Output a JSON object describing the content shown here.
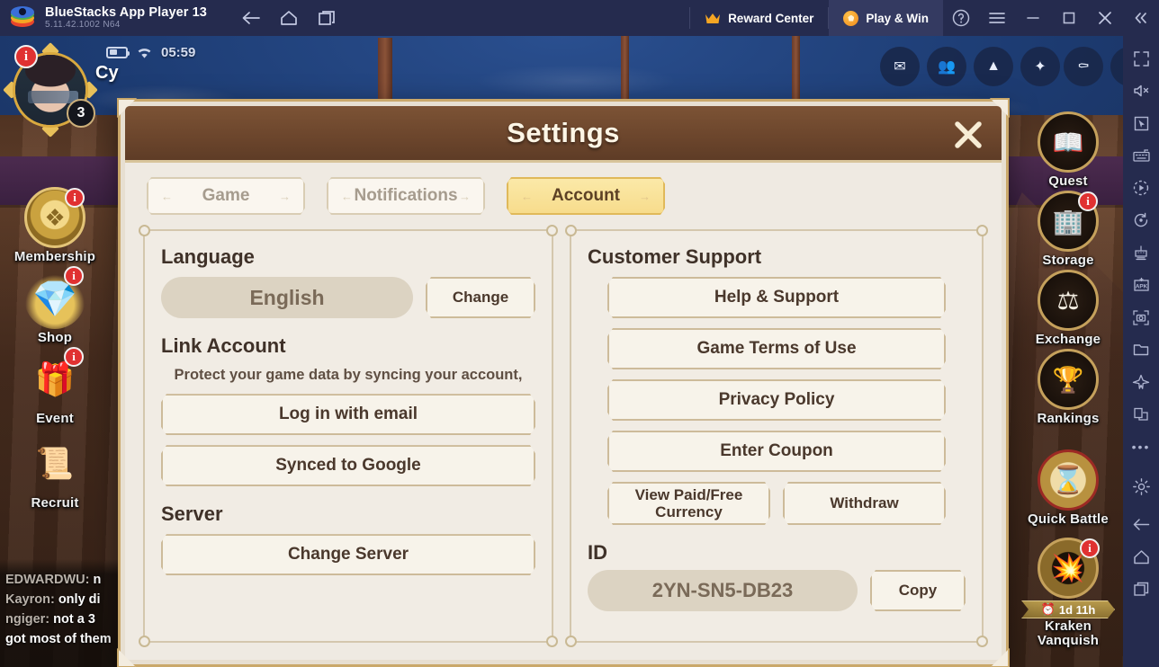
{
  "titlebar": {
    "app_name": "BlueStacks App Player 13",
    "version": "5.11.42.1002  N64",
    "back_icon": "back-arrow-icon",
    "home_icon": "home-icon",
    "multi_instance_icon": "multi-instance-icon",
    "reward_center": "Reward Center",
    "play_and_win": "Play & Win",
    "help_icon": "help-icon",
    "menu_icon": "hamburger-menu-icon",
    "minimize_icon": "minimize-icon",
    "maximize_icon": "maximize-icon",
    "close_icon": "close-icon",
    "collapse_icon": "collapse-chevrons-icon",
    "accent": "#f5a623",
    "bar_bg": "#252b4e"
  },
  "game": {
    "status": {
      "time": "05:59",
      "battery_icon": "battery-icon",
      "wifi_icon": "wifi-icon"
    },
    "player": {
      "name": "Cy",
      "level": "3",
      "alert": "i"
    },
    "left_menu": [
      {
        "label": "Membership",
        "icon": "membership-emblem-icon",
        "badge": "i"
      },
      {
        "label": "Shop",
        "icon": "treasure-chest-icon",
        "badge": "i"
      },
      {
        "label": "Event",
        "icon": "event-banner-icon",
        "badge": "i"
      },
      {
        "label": "Recruit",
        "icon": "recruit-scroll-icon",
        "badge": ""
      }
    ],
    "right_menu": [
      {
        "label": "Quest",
        "icon": "open-book-icon",
        "badge": ""
      },
      {
        "label": "Storage",
        "icon": "warehouse-icon",
        "badge": "i"
      },
      {
        "label": "Exchange",
        "icon": "scales-icon",
        "badge": ""
      },
      {
        "label": "Rankings",
        "icon": "trophy-icon",
        "badge": ""
      },
      {
        "label": "Quick Battle",
        "icon": "hourglass-icon",
        "badge": ""
      },
      {
        "label": "Kraken Vanquish",
        "icon": "cannon-icon",
        "badge": "i",
        "timer": "1d 11h",
        "timer_icon": "clock-icon"
      }
    ],
    "top_icons": [
      "mail-icon",
      "friends-icon",
      "guild-icon",
      "effects-icon",
      "sail-icon",
      "settings-gear-icon"
    ],
    "chat": [
      {
        "name": "EDWARDWU:",
        "text": "n"
      },
      {
        "name": "Kayron:",
        "text": "only di"
      },
      {
        "name": "ngiger:",
        "text": "not a 3"
      },
      {
        "name": "",
        "text": "got most of them"
      }
    ]
  },
  "dialog": {
    "title": "Settings",
    "close_icon": "dialog-close-icon",
    "tabs": [
      {
        "label": "Game",
        "active": false
      },
      {
        "label": "Notifications",
        "active": false
      },
      {
        "label": "Account",
        "active": true
      }
    ],
    "left_panel": {
      "language_title": "Language",
      "language_value": "English",
      "change_label": "Change",
      "link_account_title": "Link Account",
      "link_account_note": "Protect your game data by syncing your account,",
      "login_email_label": "Log in with email",
      "synced_google_label": "Synced to Google",
      "server_title": "Server",
      "change_server_label": "Change Server"
    },
    "right_panel": {
      "support_title": "Customer Support",
      "help_support_label": "Help & Support",
      "terms_label": "Game Terms of Use",
      "privacy_label": "Privacy Policy",
      "coupon_label": "Enter Coupon",
      "currency_label": "View Paid/Free Currency",
      "withdraw_label": "Withdraw",
      "id_title": "ID",
      "id_value": "2YN-SN5-DB23",
      "copy_label": "Copy"
    },
    "colors": {
      "header": "#6b452c",
      "body": "#efeae2",
      "frame": "#caa86a",
      "tab_active": "#f7dc8c"
    }
  },
  "bs_sidebar": [
    "fullscreen-icon",
    "mute-icon",
    "pointer-icon",
    "keyboard-controls-icon",
    "macro-play-icon",
    "rotate-icon",
    "multi-instance-manager-icon",
    "install-apk-icon",
    "screenshot-icon",
    "media-folder-icon",
    "airplane-icon",
    "copy-window-icon",
    "more-options-icon",
    "settings-gear-icon",
    "back-arrow-icon",
    "home-icon",
    "recents-icon"
  ]
}
